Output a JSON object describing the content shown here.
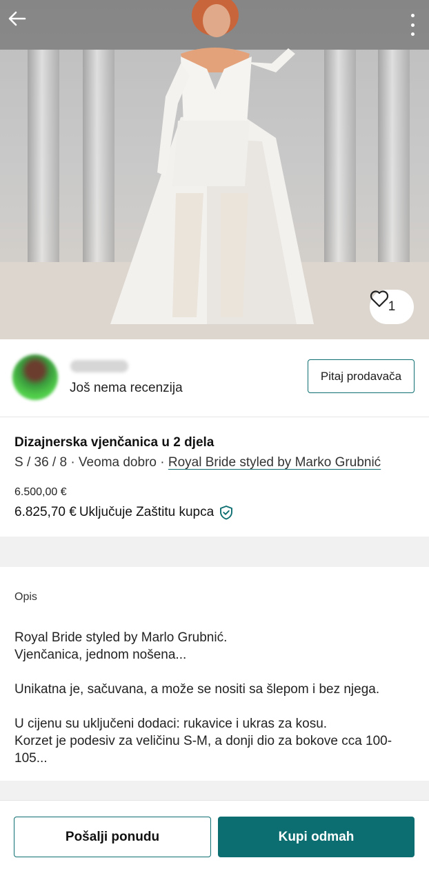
{
  "header": {
    "back_icon": "arrow-left-icon",
    "menu_icon": "more-vertical-icon"
  },
  "photo": {
    "description_icon": "wedding-dress-photo",
    "favorites_count": "1",
    "favorite_icon": "heart-outline-icon"
  },
  "seller": {
    "reviews_text": "Još nema recenzija",
    "ask_button": "Pitaj prodavača"
  },
  "item": {
    "title": "Dizajnerska vjenčanica u 2 djela",
    "meta_prefix": "S / 36 / 8 · Veoma dobro · ",
    "brand": "Royal Bride styled by Marko Grubnić",
    "price": "6.500,00 €",
    "total_price": "6.825,70 €",
    "buyer_protection": "Uključuje Zaštitu kupca",
    "shield_icon": "shield-check-icon"
  },
  "description": {
    "label": "Opis",
    "lines": [
      "Royal Bride styled by Marlo Grubnić.",
      "Vjenčanica, jednom nošena...",
      "",
      "Unikatna je, sačuvana, a može se nositi sa šlepom i bez njega.",
      "",
      "U cijenu su uključeni dodaci: rukavice i ukras za kosu.",
      "Korzet je podesiv za veličinu S-M, a donji dio za bokove cca 100-105..."
    ]
  },
  "actions": {
    "offer_button": "Pošalji ponudu",
    "buy_button": "Kupi odmah"
  },
  "colors": {
    "accent": "#0c6e70",
    "background_band": "#f1f1f1"
  }
}
